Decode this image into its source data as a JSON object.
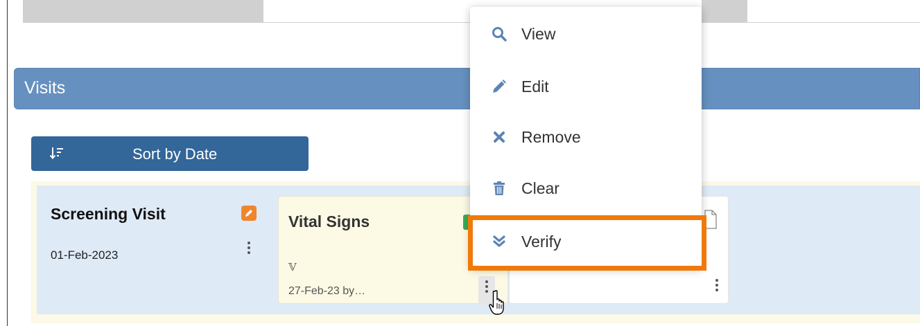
{
  "visits": {
    "title": "Visits"
  },
  "sort_button": {
    "label": "Sort by Date",
    "icon": "sort-descending-icon"
  },
  "visit": {
    "name": "Screening Visit",
    "date": "01-Feb-2023",
    "edit_icon_color": "#f0862c"
  },
  "form_cards": [
    {
      "title": "Vital Signs",
      "status_glyph": "𝕍",
      "meta": "27-Feb-23 by…",
      "background": "#fcf9e4"
    },
    {
      "icon": "document-icon"
    }
  ],
  "context_menu": {
    "items": [
      {
        "label": "View",
        "icon": "search-icon"
      },
      {
        "label": "Edit",
        "icon": "pencil-icon"
      },
      {
        "label": "Remove",
        "icon": "x-icon"
      },
      {
        "label": "Clear",
        "icon": "trash-icon"
      },
      {
        "label": "Verify",
        "icon": "double-chevron-down-icon"
      }
    ],
    "highlight_color": "#ef7a0a",
    "icon_color": "#5b84b3"
  },
  "colors": {
    "header_bg": "#6690bf",
    "button_bg": "#336699",
    "panel_bg": "#dfeaf7"
  }
}
